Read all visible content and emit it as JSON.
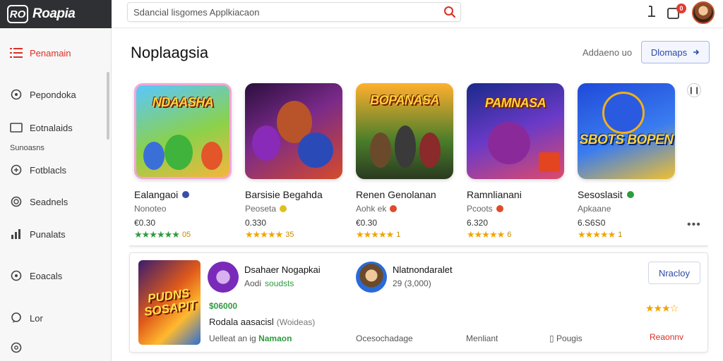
{
  "app": {
    "title": "Roapia",
    "logo_text": "RO"
  },
  "search": {
    "placeholder": "Sdancial lisgomes Applkiacaon"
  },
  "topbar": {
    "notif_count": "0"
  },
  "sidebar": {
    "items": [
      {
        "label": "Penamain",
        "icon": "menu-icon",
        "active": true
      },
      {
        "label": "Pepondoka",
        "icon": "circle-icon"
      },
      {
        "label": "Eotnalaids",
        "icon": "screen-icon"
      },
      {
        "label": "Fotblacls",
        "icon": "gamepad-icon"
      },
      {
        "label": "Seadnels",
        "icon": "target-icon"
      },
      {
        "label": "Punalats",
        "icon": "chart-icon"
      },
      {
        "label": "Eoacals",
        "icon": "circle-icon"
      },
      {
        "label": "Lor",
        "icon": "chat-icon"
      }
    ],
    "section_label": "Sunoasns",
    "accent": "#d93025"
  },
  "main": {
    "section_title": "Noplaagsia",
    "see_all": "Addaeno uo",
    "more_button": "Dlomaps",
    "next_label": "❙❙"
  },
  "games": [
    {
      "thumb_title": "NDAASHA",
      "name": "Ealangaoi",
      "dev": "Nonoteo",
      "price": "€0.30",
      "stars": "★★★★★★",
      "count": "05",
      "star_color": "green",
      "grad": "linear-gradient(160deg,#59c7ff 0%,#8bd14a 55%,#f5b63d 100%)",
      "border": "#f2a7d6"
    },
    {
      "thumb_title": "",
      "name": "Barsisie Begahda",
      "dev": "Peoseta",
      "price": "0.330",
      "stars": "★★★★★",
      "count": "35",
      "star_color": "orange",
      "grad": "linear-gradient(150deg,#2b0f3d 0%,#7a2a8a 45%,#d64b2a 100%)",
      "border": "#7a2a8a"
    },
    {
      "thumb_title": "BOPANASA",
      "name": "Renen Genolanan",
      "dev": "Aohk ek",
      "price": "€0.30",
      "stars": "★★★★★",
      "count": "1",
      "star_color": "orange",
      "grad": "linear-gradient(180deg,#ffb02e 0%,#4a7d2a 60%,#2a3a20 100%)",
      "border": "#d8892a"
    },
    {
      "thumb_title": "PAMNASA",
      "name": "Ramnlianani",
      "dev": "Pcoots",
      "price": "6.320",
      "stars": "★★★★★",
      "count": "6",
      "star_color": "orange",
      "grad": "linear-gradient(160deg,#1a2a8a 0%,#6a3ac8 50%,#e04a6a 100%)",
      "border": "#3a3ab8"
    },
    {
      "thumb_title": "SBOTS BOPEN",
      "name": "Sesoslasit",
      "dev": "Apkaane",
      "price": "6.S6S0",
      "stars": "★★★★★",
      "count": "1",
      "star_color": "orange",
      "grad": "linear-gradient(160deg,#1f4ad8 0%,#3a7cf0 55%,#f0c030 100%)",
      "border": "#2a5ae0"
    }
  ],
  "feature": {
    "thumb_title": "PUDNS SOSAPIT",
    "title_1": "Dsahaer Nogapkai",
    "sub_1": "Aodi",
    "sub_1_tag": "soudsts",
    "price": "$06000",
    "desc": "Rodala aasacisl",
    "desc_note": "(Woideas)",
    "title_2": "Nlatnondaralet",
    "sub_2": "29 (3,000)",
    "install": "Nracloy",
    "link_1_prefix": "Uelleat an",
    "link_1_tag": "ig",
    "link_1_green": "Namaon",
    "link_2": "Ocesochadage",
    "link_3": "Menliant",
    "link_4": "Pougis",
    "report": "Reaonnv",
    "stars": "★★★☆"
  },
  "colors": {
    "accent_red": "#d93025",
    "link_blue": "#2b4aa8",
    "green": "#2e9b3e",
    "star_orange": "#f0a500"
  }
}
